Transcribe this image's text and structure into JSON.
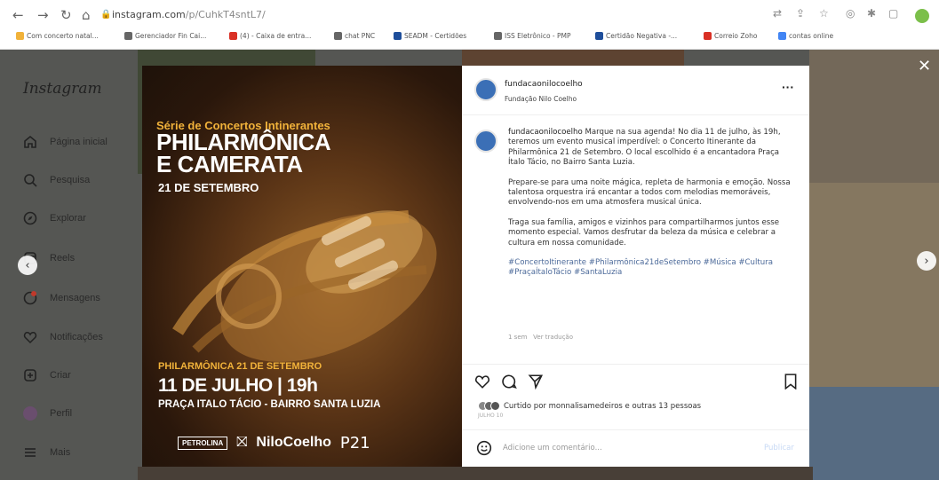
{
  "browser": {
    "url_host": "instagram.com",
    "url_path": "/p/CuhkT4sntL7/",
    "bookmarks": [
      {
        "label": "Com concerto natal...",
        "color": "#f1b23a"
      },
      {
        "label": "Gerenciador Fin Cai...",
        "color": "#666666"
      },
      {
        "label": "(4) - Caixa de entra...",
        "color": "#d93025"
      },
      {
        "label": "chat PNC",
        "color": "#666666"
      },
      {
        "label": "SEADM - Certidões",
        "color": "#1e4e9b"
      },
      {
        "label": "ISS Eletrônico - PMP",
        "color": "#666666"
      },
      {
        "label": "Certidão Negativa -...",
        "color": "#1e4e9b"
      },
      {
        "label": "Correio Zoho",
        "color": "#d93025"
      },
      {
        "label": "contas online",
        "color": "#4285f4"
      }
    ]
  },
  "sidebar": {
    "logo": "Instagram",
    "items": [
      {
        "label": "Página inicial",
        "icon": "home-icon"
      },
      {
        "label": "Pesquisa",
        "icon": "search-icon"
      },
      {
        "label": "Explorar",
        "icon": "compass-icon"
      },
      {
        "label": "Reels",
        "icon": "reels-icon"
      },
      {
        "label": "Mensagens",
        "icon": "messenger-icon"
      },
      {
        "label": "Notificações",
        "icon": "heart-icon"
      },
      {
        "label": "Criar",
        "icon": "plus-square-icon"
      },
      {
        "label": "Perfil",
        "icon": "profile-avatar"
      },
      {
        "label": "Mais",
        "icon": "menu-icon"
      }
    ]
  },
  "poster": {
    "subtitle": "Série de Concertos Intinerantes",
    "title_line1": "PHILARMÔNICA",
    "title_line2": "E CAMERATA",
    "date_line": "21 DE SETEMBRO",
    "small_title": "PHILARMÔNICA 21 DE SETEMBRO",
    "big_date": "11 DE JULHO | 19h",
    "place": "PRAÇA ITALO TÁCIO - BAIRRO SANTA LUZIA",
    "logo1": "PETROLINA",
    "logo2": "NiloCoelho",
    "logo3": "P21"
  },
  "post": {
    "username": "fundacaonilocoelho",
    "subtitle": "Fundação Nilo Coelho",
    "caption_user": "fundacaonilocoelho",
    "caption_p1": "Marque na sua agenda! No dia 11 de julho, às 19h, teremos um evento musical imperdível: o Concerto Itinerante da Philarmônica 21 de Setembro. O local escolhido é a encantadora Praça Ítalo Tácio, no Bairro Santa Luzia.",
    "caption_p2": "Prepare-se para uma noite mágica, repleta de harmonia e emoção. Nossa talentosa orquestra irá encantar a todos com melodias memoráveis, envolvendo-nos em uma atmosfera musical única.",
    "caption_p3": "Traga sua família, amigos e vizinhos para compartilharmos juntos esse momento especial. Vamos desfrutar da beleza da música e celebrar a cultura em nossa comunidade.",
    "hashtags": "#ConcertoItinerante #Philarmônica21deSetembro #Música #Cultura #PraçaÍtaloTácio #SantaLuzia",
    "time_ago": "1 sem",
    "translate": "Ver tradução",
    "likes_text": "Curtido por monnalisamedeiros e outras 13 pessoas",
    "date": "JULHO 10",
    "comment_placeholder": "Adicione um comentário...",
    "publish": "Publicar"
  }
}
